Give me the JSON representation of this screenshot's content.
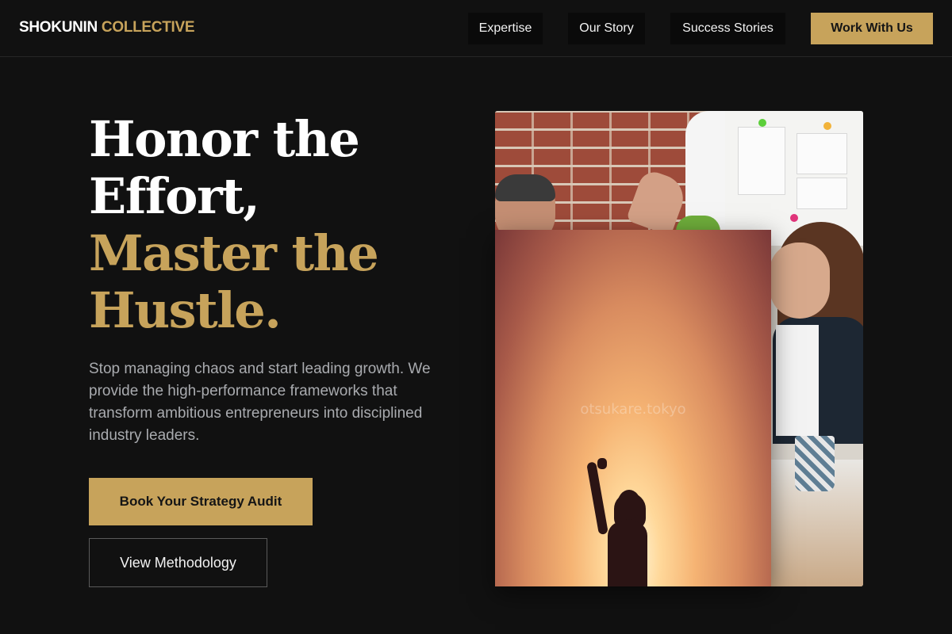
{
  "brand": {
    "name": "SHOKUNIN",
    "accent": "COLLECTIVE"
  },
  "nav": {
    "links": [
      "Expertise",
      "Our Story",
      "Success Stories"
    ],
    "cta": "Work With Us"
  },
  "hero": {
    "title_line1": "Honor the",
    "title_line2": "Effort,",
    "title_line3": "Master the",
    "title_line4": "Hustle.",
    "subtitle": "Stop managing chaos and start leading growth. We provide the high-performance frameworks that transform ambitious entrepreneurs into disciplined industry leaders.",
    "primary_button": "Book Your Strategy Audit",
    "secondary_button": "View Methodology"
  },
  "media": {
    "watermark": "otsukare.tokyo"
  },
  "colors": {
    "background": "#111111",
    "accent": "#c7a35b",
    "muted_text": "#a9abaf"
  }
}
